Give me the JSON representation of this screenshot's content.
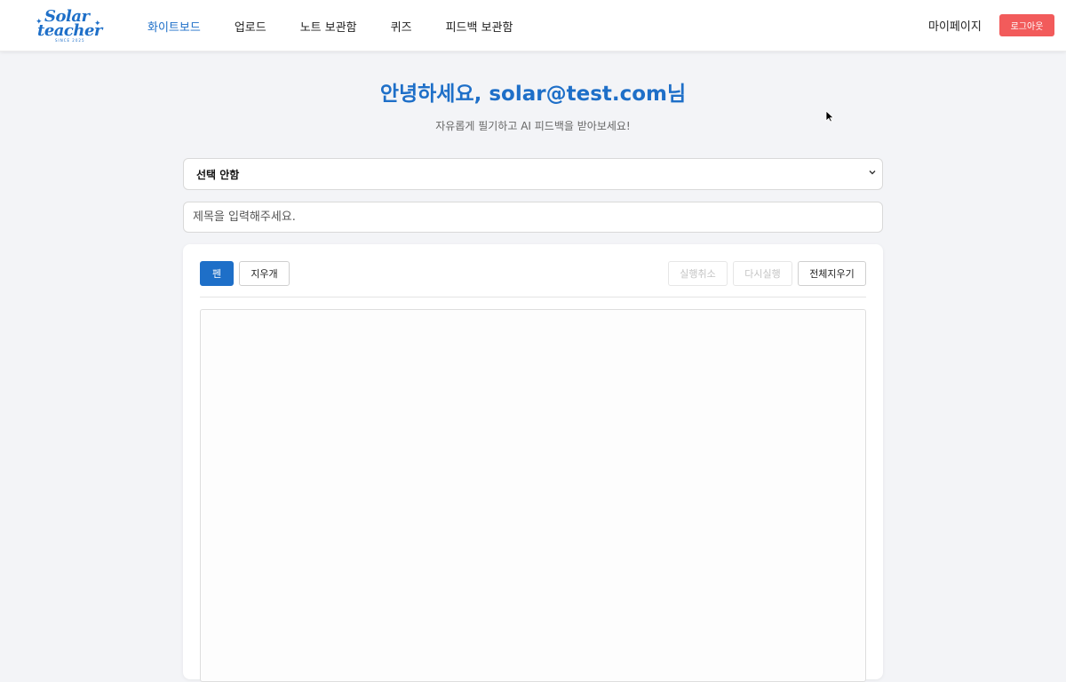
{
  "nav": {
    "logo": {
      "line1": "Solar",
      "line2": "teacher",
      "since": "SINCE 2025"
    },
    "links": [
      "화이트보드",
      "업로드",
      "노트 보관함",
      "퀴즈",
      "피드백 보관함"
    ],
    "active_index": 0,
    "mypage": "마이페이지",
    "logout": "로그아웃"
  },
  "main": {
    "greeting": "안녕하세요, solar@test.com님",
    "subtitle": "자유롭게 필기하고 AI 피드백을 받아보세요!",
    "select": {
      "value": "선택 안함"
    },
    "title_input": {
      "placeholder": "제목을 입력해주세요."
    }
  },
  "toolbar": {
    "pen": "펜",
    "eraser": "지우개",
    "undo": "실행취소",
    "redo": "다시실행",
    "clear_all": "전체지우기"
  },
  "colors": {
    "accent": "#1e6fc8",
    "logout": "#f25b5b",
    "background": "#f3f4f7"
  }
}
